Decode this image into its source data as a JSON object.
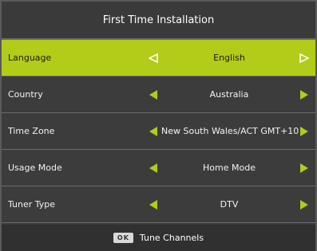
{
  "title": "First Time Installation",
  "menu": {
    "items": [
      {
        "label": "Language",
        "value": "English",
        "selected": true
      },
      {
        "label": "Country",
        "value": "Australia",
        "selected": false
      },
      {
        "label": "Time Zone",
        "value": "New South Wales/ACT GMT+10",
        "selected": false
      },
      {
        "label": "Usage Mode",
        "value": "Home Mode",
        "selected": false
      },
      {
        "label": "Tuner Type",
        "value": "DTV",
        "selected": false
      }
    ]
  },
  "footer": {
    "key_label": "OK",
    "action_label": "Tune Channels"
  },
  "colors": {
    "accent": "#b3cc19",
    "background": "#3c3c3c",
    "divider": "#6b6b6b"
  },
  "icons": {
    "left": "triangle-left-icon",
    "right": "triangle-right-icon"
  }
}
